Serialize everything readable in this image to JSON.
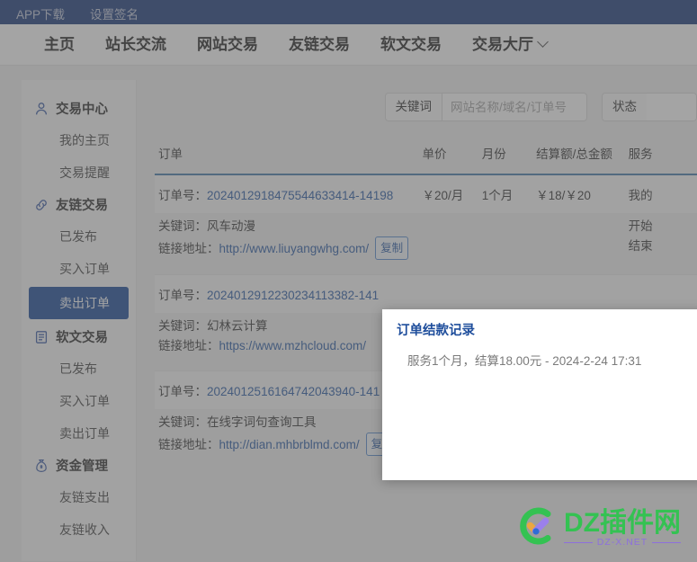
{
  "topbar": {
    "links": [
      {
        "label": "APP下载",
        "name": "topbar-app-download"
      },
      {
        "label": "设置签名",
        "name": "topbar-set-signature"
      }
    ]
  },
  "nav": {
    "items": [
      {
        "label": "主页",
        "name": "nav-home",
        "caret": false
      },
      {
        "label": "站长交流",
        "name": "nav-webmaster",
        "caret": false
      },
      {
        "label": "网站交易",
        "name": "nav-site-trade",
        "caret": false
      },
      {
        "label": "友链交易",
        "name": "nav-link-trade",
        "caret": false
      },
      {
        "label": "软文交易",
        "name": "nav-article-trade",
        "caret": false
      },
      {
        "label": "交易大厅",
        "name": "nav-trade-hall",
        "caret": true
      }
    ]
  },
  "sidebar": {
    "groups": [
      {
        "label": "交易中心",
        "icon": "user-icon",
        "items": [
          {
            "label": "我的主页",
            "active": false
          },
          {
            "label": "交易提醒",
            "active": false
          }
        ]
      },
      {
        "label": "友链交易",
        "icon": "link-icon",
        "items": [
          {
            "label": "已发布",
            "active": false
          },
          {
            "label": "买入订单",
            "active": false
          },
          {
            "label": "卖出订单",
            "active": true
          }
        ]
      },
      {
        "label": "软文交易",
        "icon": "document-icon",
        "items": [
          {
            "label": "已发布",
            "active": false
          },
          {
            "label": "买入订单",
            "active": false
          },
          {
            "label": "卖出订单",
            "active": false
          }
        ]
      },
      {
        "label": "资金管理",
        "icon": "money-bag-icon",
        "items": [
          {
            "label": "友链支出",
            "active": false
          },
          {
            "label": "友链收入",
            "active": false
          }
        ]
      }
    ]
  },
  "filters": {
    "keyword_label": "关键词",
    "keyword_value": "",
    "keyword_placeholder": "网站名称/域名/订单号",
    "status_label": "状态",
    "status_value": ""
  },
  "table": {
    "headers": [
      "订单",
      "单价",
      "月份",
      "结算额/总金额",
      "服务"
    ],
    "order_prefix": "订单号：",
    "keyword_prefix": "关键词：",
    "url_prefix": "链接地址：",
    "copy_label": "复制",
    "rows": [
      {
        "order_no": "2024012918475544633414-14198",
        "price": "￥20/月",
        "months": "1个月",
        "amount": "￥18/￥20",
        "service": "我的",
        "keyword": "风车动漫",
        "url": "http://www.liuyangwhg.com/",
        "detail_line1": "开始",
        "detail_line2": "结束"
      },
      {
        "order_no": "2024012912230234113382-141",
        "price": "",
        "months": "",
        "amount": "",
        "service": "",
        "keyword": "幻林云计算",
        "url": "https://www.mzhcloud.com/",
        "detail_line1": "",
        "detail_line2": ""
      },
      {
        "order_no": "2024012516164742043940-141",
        "price": "",
        "months": "",
        "amount": "",
        "service": "",
        "keyword": "在线字词句查询工具",
        "url": "http://dian.mhbrblmd.com/",
        "detail_line1": "",
        "detail_line2": ""
      }
    ]
  },
  "popup": {
    "title": "订单结款记录",
    "record": "服务1个月，结算18.00元 - 2024-2-24 17:31"
  },
  "watermark": {
    "main": "DZ插件网",
    "sub": "DZ-X.NET"
  },
  "colors": {
    "topbar": "#1f3f7e",
    "accent": "#1f4e9c",
    "link": "#2f5fa8",
    "header_underline": "#4a7fae",
    "watermark_green": "#2fc44e",
    "watermark_purple": "#8d6ee0"
  }
}
